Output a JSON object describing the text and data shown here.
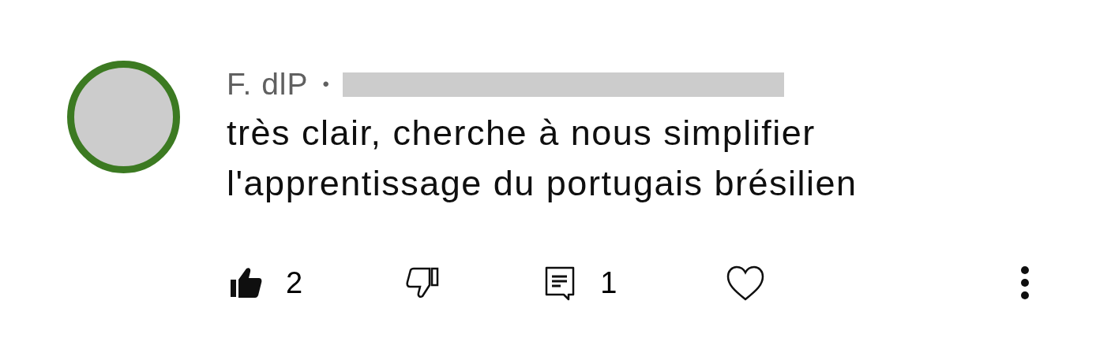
{
  "comment": {
    "author": "F. dlP",
    "separator": "•",
    "text_lines": [
      "très clair, cherche à nous simplifier",
      "l'apprentissage du portugais brésilien"
    ],
    "likes": "2",
    "liked": true,
    "disliked": false,
    "replies": "1",
    "hearted": false
  }
}
